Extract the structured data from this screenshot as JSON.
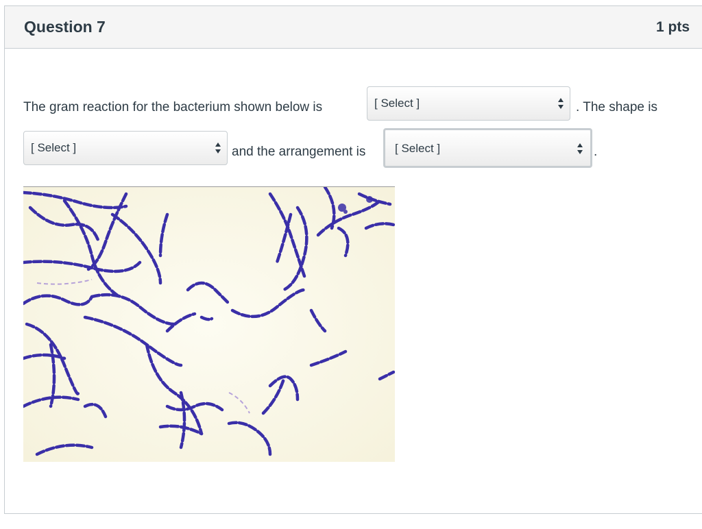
{
  "question": {
    "title": "Question 7",
    "points": "1 pts"
  },
  "prompt": {
    "part1": "The gram reaction for the bacterium shown below is",
    "part2": ". The shape is",
    "part3": "and the arrangement is",
    "part4": "."
  },
  "dropdowns": {
    "gram_reaction": {
      "value": "[ Select ]"
    },
    "shape": {
      "value": "[ Select ]"
    },
    "arrangement": {
      "value": "[ Select ]"
    }
  },
  "image": {
    "subject": "Gram stain micrograph of purple rod-shaped bacteria in chains",
    "stain_color": "#3a2fa8",
    "background_color": "#fbf9ec"
  }
}
